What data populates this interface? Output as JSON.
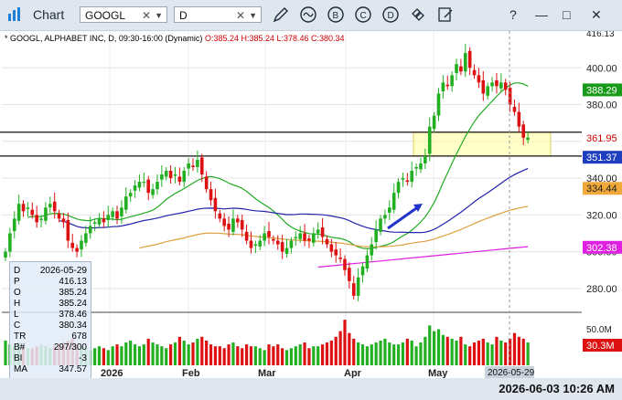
{
  "window": {
    "title": "Chart",
    "symbol": "GOOGL",
    "interval": "D",
    "clock": "2026-06-03 10:26 AM"
  },
  "toolbar_icons": [
    "draw-pen-icon",
    "indicator-wave-icon",
    "study-b-icon",
    "study-c-icon",
    "study-d-icon",
    "sync-link-icon",
    "notes-edit-icon"
  ],
  "window_buttons": {
    "help": "?",
    "minimize": "—",
    "maximize": "□",
    "close": "✕"
  },
  "info_line": {
    "prefix": "* GOOGL, ALPHABET INC, D, 09:30-16:00 (Dynamic)",
    "ohlc": "O:385.24 H:385.24 L:378.46 C:380.34"
  },
  "price_axis": {
    "labels": [
      "416.13",
      "400.00",
      "380.00",
      "361.95",
      "351.37",
      "340.00",
      "334.44",
      "320.00",
      "302.38",
      "300.00",
      "280.00",
      "388.29"
    ]
  },
  "volume_axis": {
    "labels": [
      "50.0M",
      "30.3M"
    ]
  },
  "time_axis": {
    "labels": [
      "2026",
      "Feb",
      "Mar",
      "Apr",
      "May"
    ],
    "cursor_date": "2026-05-29"
  },
  "data_window": [
    {
      "k": "D",
      "v": "2026-05-29"
    },
    {
      "k": "P",
      "v": "416.13"
    },
    {
      "k": "O",
      "v": "385.24"
    },
    {
      "k": "H",
      "v": "385.24"
    },
    {
      "k": "L",
      "v": "378.46"
    },
    {
      "k": "C",
      "v": "380.34"
    },
    {
      "k": "TR",
      "v": "678"
    },
    {
      "k": "B#",
      "v": "297/300"
    },
    {
      "k": "BI",
      "v": "-3"
    },
    {
      "k": "MA",
      "v": "347.57"
    }
  ],
  "colors": {
    "up": "#22b022",
    "down": "#dd1111",
    "ma20": "#22aa22",
    "ma50": "#2222aa",
    "ma100": "#e0a040",
    "ma200": "#e020e0",
    "zone": "#ffff99",
    "arrow": "#2233cc"
  },
  "chart_data": {
    "type": "candlestick",
    "ylim": [
      268,
      420
    ],
    "closes": [
      300,
      310,
      318,
      326,
      322,
      324,
      320,
      316,
      318,
      324,
      326,
      322,
      318,
      316,
      306,
      302,
      300,
      306,
      310,
      314,
      316,
      318,
      316,
      320,
      322,
      318,
      324,
      330,
      332,
      336,
      338,
      338,
      332,
      334,
      338,
      342,
      344,
      340,
      342,
      338,
      344,
      348,
      346,
      350,
      342,
      334,
      328,
      322,
      318,
      314,
      312,
      318,
      316,
      312,
      306,
      302,
      304,
      306,
      310,
      308,
      306,
      304,
      300,
      302,
      306,
      308,
      310,
      306,
      306,
      310,
      312,
      308,
      304,
      300,
      298,
      296,
      290,
      284,
      276,
      286,
      292,
      298,
      304,
      312,
      318,
      320,
      324,
      332,
      338,
      340,
      338,
      344,
      346,
      348,
      352,
      368,
      374,
      386,
      392,
      390,
      396,
      402,
      398,
      408,
      400,
      396,
      392,
      386,
      390,
      392,
      390,
      392,
      388,
      380,
      376,
      368,
      362,
      362
    ],
    "volume": [
      26,
      22,
      20,
      24,
      20,
      18,
      18,
      20,
      22,
      20,
      18,
      20,
      22,
      24,
      26,
      28,
      22,
      20,
      18,
      16,
      18,
      20,
      18,
      16,
      20,
      22,
      20,
      24,
      26,
      22,
      20,
      22,
      28,
      24,
      22,
      20,
      18,
      22,
      24,
      30,
      26,
      22,
      24,
      28,
      30,
      26,
      22,
      20,
      20,
      18,
      22,
      24,
      20,
      18,
      22,
      20,
      20,
      18,
      16,
      22,
      20,
      22,
      18,
      16,
      18,
      20,
      22,
      24,
      18,
      20,
      20,
      22,
      24,
      26,
      30,
      36,
      48,
      34,
      28,
      24,
      22,
      20,
      22,
      24,
      26,
      28,
      24,
      22,
      22,
      24,
      28,
      26,
      20,
      24,
      30,
      42,
      36,
      38,
      32,
      30,
      28,
      26,
      30,
      22,
      20,
      24,
      26,
      28,
      24,
      22,
      30,
      26,
      24,
      28,
      34,
      30,
      28,
      24
    ],
    "ma20_label": "388.29",
    "ma50_label": "351.37",
    "ma100_label": "334.44",
    "ma200_label": "302.38",
    "zone": {
      "top": 365,
      "bottom": 352
    },
    "hlines": [
      365,
      352
    ]
  }
}
